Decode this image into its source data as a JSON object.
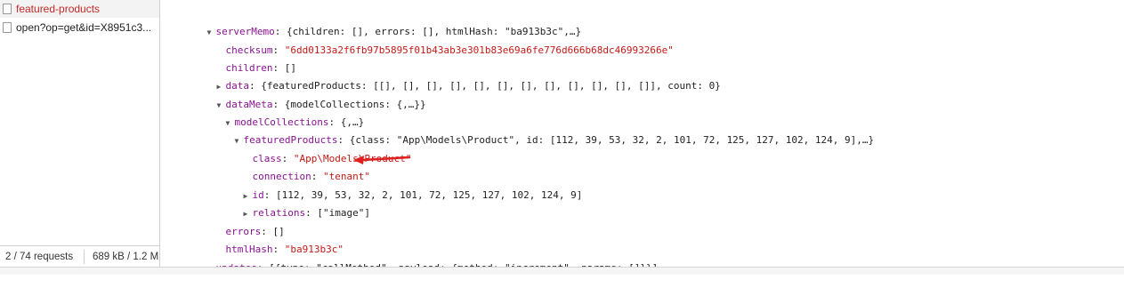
{
  "requests": [
    {
      "name": "featured-products",
      "selected": true
    },
    {
      "name": "open?op=get&id=X8951c3...",
      "selected": false
    }
  ],
  "status": {
    "requests": "2 / 74 requests",
    "size": "689 kB / 1.2 M"
  },
  "tree": {
    "serverMemo": {
      "key": "serverMemo",
      "summary": "{children: [], errors: [], htmlHash: \"ba913b3c\",…}"
    },
    "checksum": {
      "key": "checksum",
      "value": "\"6dd0133a2f6fb97b5895f01b43ab3e301b83e69a6fe776d666b68dc46993266e\""
    },
    "children": {
      "key": "children",
      "value": "[]"
    },
    "data": {
      "key": "data",
      "summary": "{featuredProducts: [[], [], [], [], [], [], [], [], [], [], [], []], count: 0}"
    },
    "dataMeta": {
      "key": "dataMeta",
      "summary": "{modelCollections: {,…}}"
    },
    "modelCollections": {
      "key": "modelCollections",
      "summary": "{,…}"
    },
    "featuredProducts": {
      "key": "featuredProducts",
      "summary": "{class: \"App\\Models\\Product\", id: [112, 39, 53, 32, 2, 101, 72, 125, 127, 102, 124, 9],…}"
    },
    "class": {
      "key": "class",
      "value": "\"App\\Models\\Product\""
    },
    "connection": {
      "key": "connection",
      "value": "\"tenant\""
    },
    "id": {
      "key": "id",
      "summary": "[112, 39, 53, 32, 2, 101, 72, 125, 127, 102, 124, 9]"
    },
    "relations": {
      "key": "relations",
      "summary": "[\"image\"]"
    },
    "errors": {
      "key": "errors",
      "value": "[]"
    },
    "htmlHash": {
      "key": "htmlHash",
      "value": "\"ba913b3c\""
    },
    "updates": {
      "key": "updates",
      "summary": "[{type: \"callMethod\", payload: {method: \"increment\", params: []}}]"
    }
  },
  "colors": {
    "key": "#881391",
    "string": "#c41a16",
    "arrow": "#e02020",
    "selected": "#c62828"
  }
}
